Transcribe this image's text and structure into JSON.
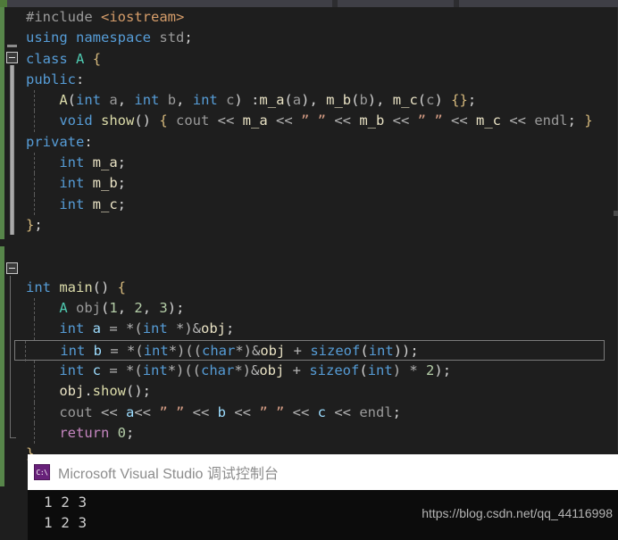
{
  "window": {
    "theme": "visual-studio-dark",
    "colors": {
      "editor_background": "#1e1e1e",
      "chrome_background": "#2d2d30",
      "keyword": "#569cd6",
      "control_keyword": "#c586c0",
      "type": "#4ec9b0",
      "function": "#dcdcaa",
      "string": "#d69d85",
      "number": "#b5cea8",
      "field": "#e9e2c4",
      "preprocessor": "#9b9b9b",
      "change_marker_green": "#57864a",
      "console_accent_purple": "#68217a"
    }
  },
  "editor": {
    "language": "C++",
    "current_line_number": 19,
    "outlining": [
      {
        "line": 3,
        "label": "class-A-region",
        "state": "expanded",
        "icon": "minus-square-icon"
      },
      {
        "line": 17,
        "label": "main-function-region",
        "state": "expanded",
        "icon": "minus-square-icon"
      }
    ],
    "lines": [
      {
        "n": 1,
        "indent": 0,
        "current": false,
        "tokens": [
          {
            "t": "#include ",
            "c": "t-pp"
          },
          {
            "t": "<iostream>",
            "c": "t-ppstr"
          }
        ]
      },
      {
        "n": 2,
        "indent": 0,
        "current": false,
        "tokens": [
          {
            "t": "using",
            "c": "t-kw"
          },
          {
            "t": " ",
            "c": "t-plain"
          },
          {
            "t": "namespace",
            "c": "t-kw"
          },
          {
            "t": " ",
            "c": "t-plain"
          },
          {
            "t": "std",
            "c": "t-param"
          },
          {
            "t": ";",
            "c": "t-punc"
          }
        ]
      },
      {
        "n": 3,
        "indent": 0,
        "current": false,
        "tokens": [
          {
            "t": "class",
            "c": "t-kw"
          },
          {
            "t": " ",
            "c": "t-plain"
          },
          {
            "t": "A",
            "c": "t-type"
          },
          {
            "t": " ",
            "c": "t-plain"
          },
          {
            "t": "{",
            "c": "t-brace"
          }
        ]
      },
      {
        "n": 4,
        "indent": 0,
        "current": false,
        "tokens": [
          {
            "t": "public",
            "c": "t-kw"
          },
          {
            "t": ":",
            "c": "t-punc"
          }
        ]
      },
      {
        "n": 5,
        "indent": 1,
        "current": false,
        "tokens": [
          {
            "t": "    ",
            "c": "t-plain"
          },
          {
            "t": "A",
            "c": "t-func"
          },
          {
            "t": "(",
            "c": "t-punc"
          },
          {
            "t": "int",
            "c": "t-kw"
          },
          {
            "t": " ",
            "c": "t-plain"
          },
          {
            "t": "a",
            "c": "t-param"
          },
          {
            "t": ", ",
            "c": "t-punc"
          },
          {
            "t": "int",
            "c": "t-kw"
          },
          {
            "t": " ",
            "c": "t-plain"
          },
          {
            "t": "b",
            "c": "t-param"
          },
          {
            "t": ", ",
            "c": "t-punc"
          },
          {
            "t": "int",
            "c": "t-kw"
          },
          {
            "t": " ",
            "c": "t-plain"
          },
          {
            "t": "c",
            "c": "t-param"
          },
          {
            "t": ") :",
            "c": "t-punc"
          },
          {
            "t": "m_a",
            "c": "t-field"
          },
          {
            "t": "(",
            "c": "t-punc"
          },
          {
            "t": "a",
            "c": "t-param"
          },
          {
            "t": "), ",
            "c": "t-punc"
          },
          {
            "t": "m_b",
            "c": "t-field"
          },
          {
            "t": "(",
            "c": "t-punc"
          },
          {
            "t": "b",
            "c": "t-param"
          },
          {
            "t": "), ",
            "c": "t-punc"
          },
          {
            "t": "m_c",
            "c": "t-field"
          },
          {
            "t": "(",
            "c": "t-punc"
          },
          {
            "t": "c",
            "c": "t-param"
          },
          {
            "t": ") ",
            "c": "t-punc"
          },
          {
            "t": "{}",
            "c": "t-brace"
          },
          {
            "t": ";",
            "c": "t-punc"
          }
        ]
      },
      {
        "n": 6,
        "indent": 1,
        "current": false,
        "tokens": [
          {
            "t": "    ",
            "c": "t-plain"
          },
          {
            "t": "void",
            "c": "t-kw"
          },
          {
            "t": " ",
            "c": "t-plain"
          },
          {
            "t": "show",
            "c": "t-func"
          },
          {
            "t": "() ",
            "c": "t-punc"
          },
          {
            "t": "{",
            "c": "t-brace"
          },
          {
            "t": " ",
            "c": "t-plain"
          },
          {
            "t": "cout",
            "c": "t-param"
          },
          {
            "t": " << ",
            "c": "t-op"
          },
          {
            "t": "m_a",
            "c": "t-field"
          },
          {
            "t": " << ",
            "c": "t-op"
          },
          {
            "t": "” ”",
            "c": "t-str"
          },
          {
            "t": " << ",
            "c": "t-op"
          },
          {
            "t": "m_b",
            "c": "t-field"
          },
          {
            "t": " << ",
            "c": "t-op"
          },
          {
            "t": "” ”",
            "c": "t-str"
          },
          {
            "t": " << ",
            "c": "t-op"
          },
          {
            "t": "m_c",
            "c": "t-field"
          },
          {
            "t": " << ",
            "c": "t-op"
          },
          {
            "t": "endl",
            "c": "t-param"
          },
          {
            "t": "; ",
            "c": "t-punc"
          },
          {
            "t": "}",
            "c": "t-brace"
          }
        ]
      },
      {
        "n": 7,
        "indent": 0,
        "current": false,
        "tokens": [
          {
            "t": "private",
            "c": "t-kw"
          },
          {
            "t": ":",
            "c": "t-punc"
          }
        ]
      },
      {
        "n": 8,
        "indent": 1,
        "current": false,
        "tokens": [
          {
            "t": "    ",
            "c": "t-plain"
          },
          {
            "t": "int",
            "c": "t-kw"
          },
          {
            "t": " ",
            "c": "t-plain"
          },
          {
            "t": "m_a",
            "c": "t-field"
          },
          {
            "t": ";",
            "c": "t-punc"
          }
        ]
      },
      {
        "n": 9,
        "indent": 1,
        "current": false,
        "tokens": [
          {
            "t": "    ",
            "c": "t-plain"
          },
          {
            "t": "int",
            "c": "t-kw"
          },
          {
            "t": " ",
            "c": "t-plain"
          },
          {
            "t": "m_b",
            "c": "t-field"
          },
          {
            "t": ";",
            "c": "t-punc"
          }
        ]
      },
      {
        "n": 10,
        "indent": 1,
        "current": false,
        "tokens": [
          {
            "t": "    ",
            "c": "t-plain"
          },
          {
            "t": "int",
            "c": "t-kw"
          },
          {
            "t": " ",
            "c": "t-plain"
          },
          {
            "t": "m_c",
            "c": "t-field"
          },
          {
            "t": ";",
            "c": "t-punc"
          }
        ]
      },
      {
        "n": 11,
        "indent": 0,
        "current": false,
        "tokens": [
          {
            "t": "}",
            "c": "t-brace"
          },
          {
            "t": ";",
            "c": "t-punc"
          }
        ]
      },
      {
        "n": 12,
        "indent": 0,
        "current": false,
        "tokens": []
      },
      {
        "n": 13,
        "indent": 0,
        "current": false,
        "tokens": []
      },
      {
        "n": 14,
        "indent": 0,
        "current": false,
        "tokens": [
          {
            "t": "int",
            "c": "t-kw"
          },
          {
            "t": " ",
            "c": "t-plain"
          },
          {
            "t": "main",
            "c": "t-func"
          },
          {
            "t": "() ",
            "c": "t-punc"
          },
          {
            "t": "{",
            "c": "t-brace"
          }
        ]
      },
      {
        "n": 15,
        "indent": 1,
        "current": false,
        "tokens": [
          {
            "t": "    ",
            "c": "t-plain"
          },
          {
            "t": "A",
            "c": "t-type"
          },
          {
            "t": " ",
            "c": "t-plain"
          },
          {
            "t": "obj",
            "c": "t-param"
          },
          {
            "t": "(",
            "c": "t-punc"
          },
          {
            "t": "1",
            "c": "t-num"
          },
          {
            "t": ", ",
            "c": "t-punc"
          },
          {
            "t": "2",
            "c": "t-num"
          },
          {
            "t": ", ",
            "c": "t-punc"
          },
          {
            "t": "3",
            "c": "t-num"
          },
          {
            "t": ");",
            "c": "t-punc"
          }
        ]
      },
      {
        "n": 16,
        "indent": 1,
        "current": false,
        "tokens": [
          {
            "t": "    ",
            "c": "t-plain"
          },
          {
            "t": "int",
            "c": "t-kw"
          },
          {
            "t": " ",
            "c": "t-plain"
          },
          {
            "t": "a",
            "c": "t-id"
          },
          {
            "t": " = *(",
            "c": "t-op"
          },
          {
            "t": "int",
            "c": "t-kw"
          },
          {
            "t": " *)&",
            "c": "t-op"
          },
          {
            "t": "obj",
            "c": "t-field"
          },
          {
            "t": ";",
            "c": "t-punc"
          }
        ]
      },
      {
        "n": 17,
        "indent": 1,
        "current": true,
        "tokens": [
          {
            "t": "    ",
            "c": "t-plain"
          },
          {
            "t": "int",
            "c": "t-kw"
          },
          {
            "t": " ",
            "c": "t-plain"
          },
          {
            "t": "b",
            "c": "t-id"
          },
          {
            "t": " = *(",
            "c": "t-op"
          },
          {
            "t": "int",
            "c": "t-kw"
          },
          {
            "t": "*)((",
            "c": "t-op"
          },
          {
            "t": "char",
            "c": "t-kw"
          },
          {
            "t": "*)&",
            "c": "t-op"
          },
          {
            "t": "obj",
            "c": "t-field"
          },
          {
            "t": " + ",
            "c": "t-op"
          },
          {
            "t": "sizeof",
            "c": "t-kw"
          },
          {
            "t": "(",
            "c": "t-punc"
          },
          {
            "t": "int",
            "c": "t-kw"
          },
          {
            "t": "));",
            "c": "t-punc"
          }
        ]
      },
      {
        "n": 18,
        "indent": 1,
        "current": false,
        "tokens": [
          {
            "t": "    ",
            "c": "t-plain"
          },
          {
            "t": "int",
            "c": "t-kw"
          },
          {
            "t": " ",
            "c": "t-plain"
          },
          {
            "t": "c",
            "c": "t-id"
          },
          {
            "t": " = *(",
            "c": "t-op"
          },
          {
            "t": "int",
            "c": "t-kw"
          },
          {
            "t": "*)((",
            "c": "t-op"
          },
          {
            "t": "char",
            "c": "t-kw"
          },
          {
            "t": "*)&",
            "c": "t-op"
          },
          {
            "t": "obj",
            "c": "t-field"
          },
          {
            "t": " + ",
            "c": "t-op"
          },
          {
            "t": "sizeof",
            "c": "t-kw"
          },
          {
            "t": "(",
            "c": "t-punc"
          },
          {
            "t": "int",
            "c": "t-kw"
          },
          {
            "t": ") * ",
            "c": "t-op"
          },
          {
            "t": "2",
            "c": "t-num"
          },
          {
            "t": ");",
            "c": "t-punc"
          }
        ]
      },
      {
        "n": 19,
        "indent": 1,
        "current": false,
        "tokens": [
          {
            "t": "    ",
            "c": "t-plain"
          },
          {
            "t": "obj",
            "c": "t-field"
          },
          {
            "t": ".",
            "c": "t-punc"
          },
          {
            "t": "show",
            "c": "t-func"
          },
          {
            "t": "();",
            "c": "t-punc"
          }
        ]
      },
      {
        "n": 20,
        "indent": 1,
        "current": false,
        "tokens": [
          {
            "t": "    ",
            "c": "t-plain"
          },
          {
            "t": "cout",
            "c": "t-param"
          },
          {
            "t": " << ",
            "c": "t-op"
          },
          {
            "t": "a",
            "c": "t-id"
          },
          {
            "t": "<< ",
            "c": "t-op"
          },
          {
            "t": "” ”",
            "c": "t-str"
          },
          {
            "t": " << ",
            "c": "t-op"
          },
          {
            "t": "b",
            "c": "t-id"
          },
          {
            "t": " << ",
            "c": "t-op"
          },
          {
            "t": "” ”",
            "c": "t-str"
          },
          {
            "t": " << ",
            "c": "t-op"
          },
          {
            "t": "c",
            "c": "t-id"
          },
          {
            "t": " << ",
            "c": "t-op"
          },
          {
            "t": "endl",
            "c": "t-param"
          },
          {
            "t": ";",
            "c": "t-punc"
          }
        ]
      },
      {
        "n": 21,
        "indent": 1,
        "current": false,
        "tokens": [
          {
            "t": "    ",
            "c": "t-plain"
          },
          {
            "t": "return",
            "c": "t-kw2"
          },
          {
            "t": " ",
            "c": "t-plain"
          },
          {
            "t": "0",
            "c": "t-num"
          },
          {
            "t": ";",
            "c": "t-punc"
          }
        ]
      },
      {
        "n": 22,
        "indent": 0,
        "current": false,
        "tokens": [
          {
            "t": "}",
            "c": "t-brace"
          }
        ]
      }
    ]
  },
  "console": {
    "icon": "console-cmd-icon",
    "icon_glyph": "C:\\",
    "title": "Microsoft Visual Studio 调试控制台",
    "output_lines": [
      "1 2 3",
      "1 2 3"
    ]
  },
  "watermark": {
    "text": "https://blog.csdn.net/qq_44116998"
  }
}
